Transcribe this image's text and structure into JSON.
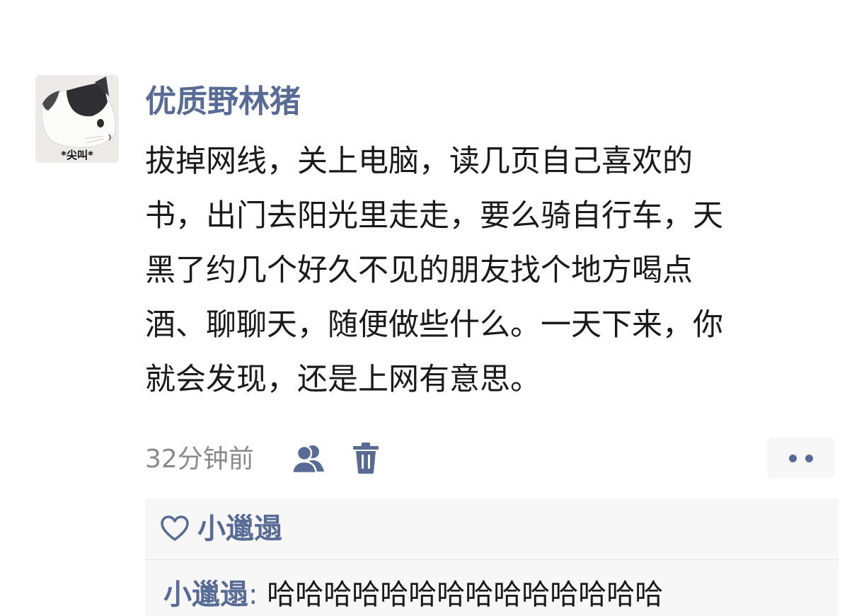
{
  "post": {
    "avatar": {
      "caption": "*尖叫*",
      "icon": "cat-avatar-icon"
    },
    "username": "优质野林猪",
    "text_lines": [
      "拔掉网线，关上电脑，读几页自己喜欢的",
      "书，出门去阳光里走走，要么骑自行车，天",
      "黑了约几个好久不见的朋友找个地方喝点",
      "酒、聊聊天，随便做些什么。一天下来，你",
      "就会发现，还是上网有意思。"
    ],
    "timestamp": "32分钟前",
    "icons": {
      "visibility": "people-visibility-icon",
      "delete": "trash-icon",
      "more": "more-dots-icon"
    }
  },
  "interactions": {
    "likes": {
      "icon": "heart-icon",
      "names": "小邋遢"
    },
    "comments": [
      {
        "author": "小邋遢",
        "separator": ": ",
        "text": "哈哈哈哈哈哈哈哈哈哈哈哈哈哈"
      }
    ]
  },
  "colors": {
    "name_link": "#576b95",
    "body_text": "#1a1a1a",
    "meta_text": "#8a8a8a",
    "panel_background": "#f7f7f7"
  }
}
